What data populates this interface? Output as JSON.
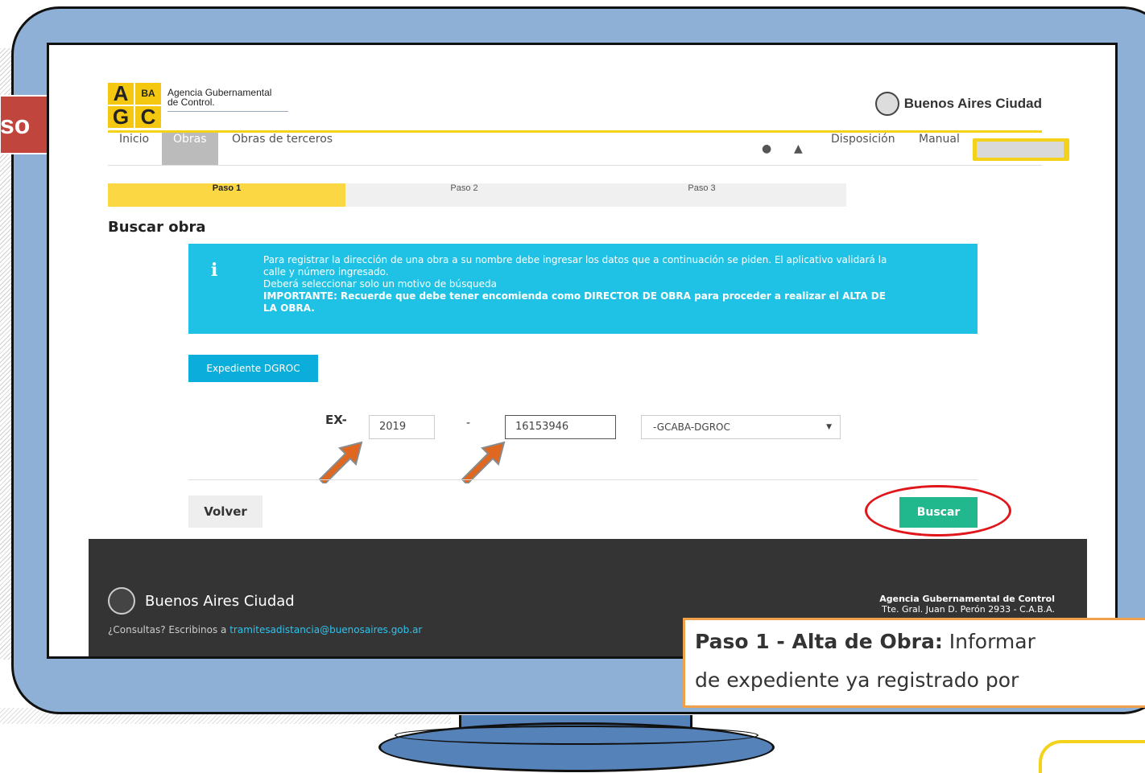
{
  "side_tab": {
    "text": "so"
  },
  "logo": {
    "letters": [
      "A",
      "BA",
      "G",
      "C"
    ],
    "line1": "Agencia Gubernamental",
    "line2": "de Control."
  },
  "brand": {
    "name": "Buenos Aires Ciudad"
  },
  "nav": {
    "items": [
      {
        "label": "Inicio"
      },
      {
        "label": "Obras",
        "active": true
      },
      {
        "label": "Obras de terceros"
      }
    ],
    "globe_icon": "globe-icon",
    "user_icon": "user-icon",
    "disposicion": "Disposición",
    "manual": "Manual"
  },
  "steps": [
    {
      "label": "Paso 1",
      "active": true
    },
    {
      "label": "Paso 2"
    },
    {
      "label": "Paso 3"
    }
  ],
  "page_title": "Buscar obra",
  "info": {
    "icon": "i",
    "line1": "Para registrar la dirección de una obra a su nombre debe ingresar los datos que a continuación se piden. El aplicativo validará la calle y número ingresado.",
    "line2": "Deberá seleccionar solo un motivo de búsqueda",
    "important": "IMPORTANTE: Recuerde que debe tener encomienda como DIRECTOR DE OBRA para proceder a realizar el ALTA DE LA OBRA."
  },
  "expediente_button": "Expediente DGROC",
  "form": {
    "prefix": "EX-",
    "year": "2019",
    "dash": "-",
    "number": "16153946",
    "suffix_selected": "-GCABA-DGROC"
  },
  "buttons": {
    "volver": "Volver",
    "buscar": "Buscar"
  },
  "footer": {
    "brand": "Buenos Aires Ciudad",
    "contact_prefix": "¿Consultas? Escribinos a ",
    "contact_email": "tramitesadistancia@buenosaires.gob.ar",
    "agency": "Agencia Gubernamental de Control",
    "address": "Tte. Gral. Juan D. Perón 2933 - C.A.B.A."
  },
  "callout": {
    "bold1": "Paso 1 - ",
    "bold2": "Alta de Obra:",
    "rest1": " Informar",
    "line2": "de expediente ya registrado por"
  },
  "colors": {
    "monitor": "#8eb0d6",
    "yellow": "#f4d21a",
    "info_blue": "#1fc2e4",
    "buscar_green": "#21b88e",
    "annotation_red": "#e0161b",
    "arrow_orange": "#e0671f"
  }
}
